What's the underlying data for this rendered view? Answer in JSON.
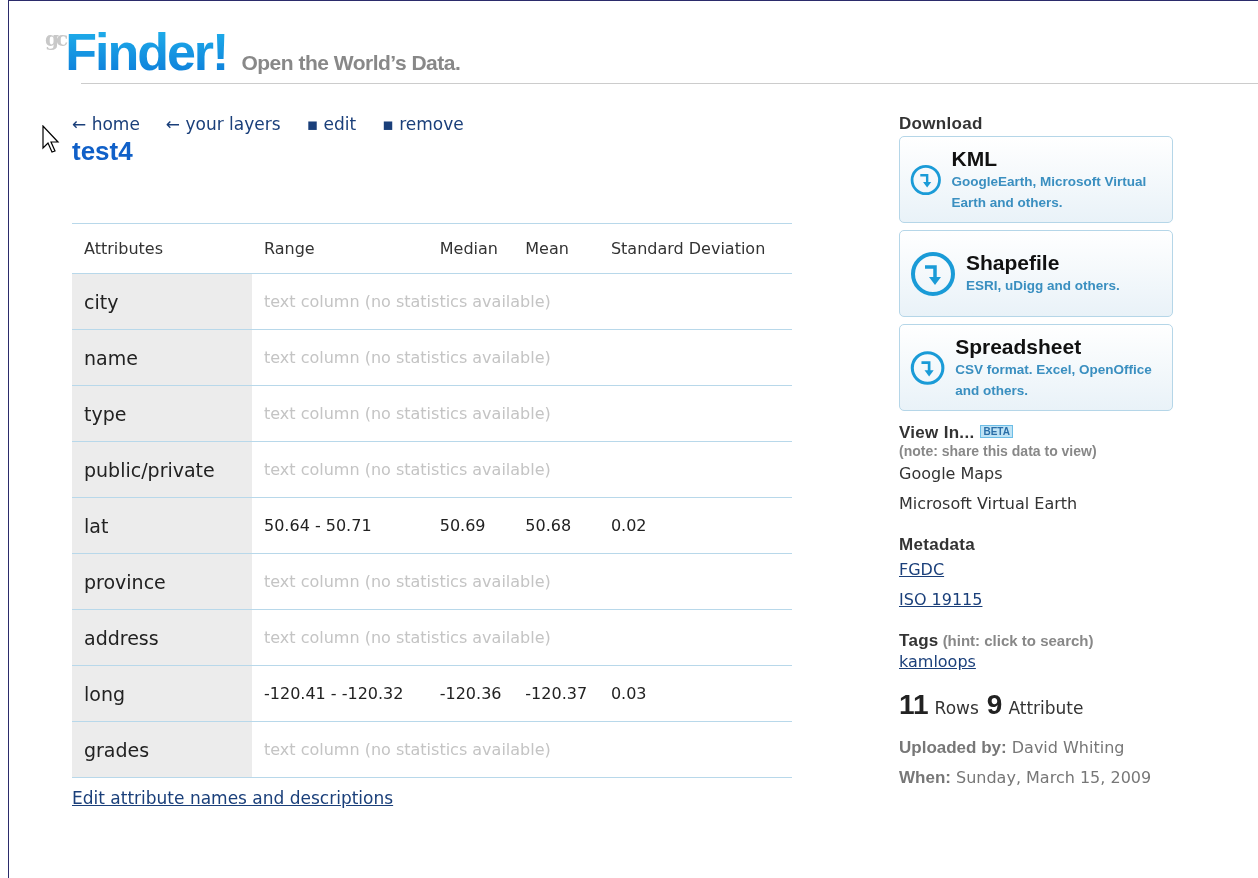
{
  "header": {
    "logo_mark": "gc",
    "logo": "Finder!",
    "tagline": "Open the World’s Data."
  },
  "nav": [
    {
      "label": "← home"
    },
    {
      "label": "← your layers"
    },
    {
      "label": "▪ edit"
    },
    {
      "label": "▪ remove"
    }
  ],
  "title": "test4",
  "table": {
    "columns": [
      "Attributes",
      "Range",
      "Median",
      "Mean",
      "Standard Deviation"
    ],
    "rows": [
      {
        "kind": "text",
        "name": "city",
        "note": "text column (no statistics available)"
      },
      {
        "kind": "text",
        "name": "name",
        "note": "text column (no statistics available)"
      },
      {
        "kind": "text",
        "name": "type",
        "note": "text column (no statistics available)"
      },
      {
        "kind": "text",
        "name": "public/private",
        "note": "text column (no statistics available)"
      },
      {
        "kind": "numeric",
        "name": "lat",
        "range": "50.64 - 50.71",
        "median": "50.69",
        "mean": "50.68",
        "std": "0.02"
      },
      {
        "kind": "text",
        "name": "province",
        "note": "text column (no statistics available)"
      },
      {
        "kind": "text",
        "name": "address",
        "note": "text column (no statistics available)"
      },
      {
        "kind": "numeric",
        "name": "long",
        "range": "-120.41 - -120.32",
        "median": "-120.36",
        "mean": "-120.37",
        "std": "0.03"
      },
      {
        "kind": "text",
        "name": "grades",
        "note": "text column (no statistics available)"
      }
    ]
  },
  "edit_link": "Edit attribute names and descriptions",
  "sidebar": {
    "download": {
      "heading": "Download",
      "buttons": [
        {
          "title": "KML",
          "subtitle": "GoogleEarth, Microsoft Virtual Earth and others."
        },
        {
          "title": "Shapefile",
          "subtitle": "ESRI, uDigg and others."
        },
        {
          "title": "Spreadsheet",
          "subtitle": "CSV format. Excel, OpenOffice and others."
        }
      ]
    },
    "view_in": {
      "heading": "View In...",
      "badge": "BETA",
      "note": "(note: share this data to view)",
      "items": [
        "Google Maps",
        "Microsoft Virtual Earth"
      ]
    },
    "metadata": {
      "heading": "Metadata",
      "links": [
        "FGDC",
        "ISO 19115"
      ]
    },
    "tags": {
      "heading": "Tags",
      "hint": "(hint: click to search)",
      "links": [
        "kamloops"
      ]
    },
    "counts": [
      {
        "number": "11",
        "label": "Rows"
      },
      {
        "number": "9",
        "label": "Attribute"
      }
    ],
    "uploaded": "**Uploaded by:** David Whiting",
    "when": "**When:** Sunday, March 15, 2009"
  }
}
